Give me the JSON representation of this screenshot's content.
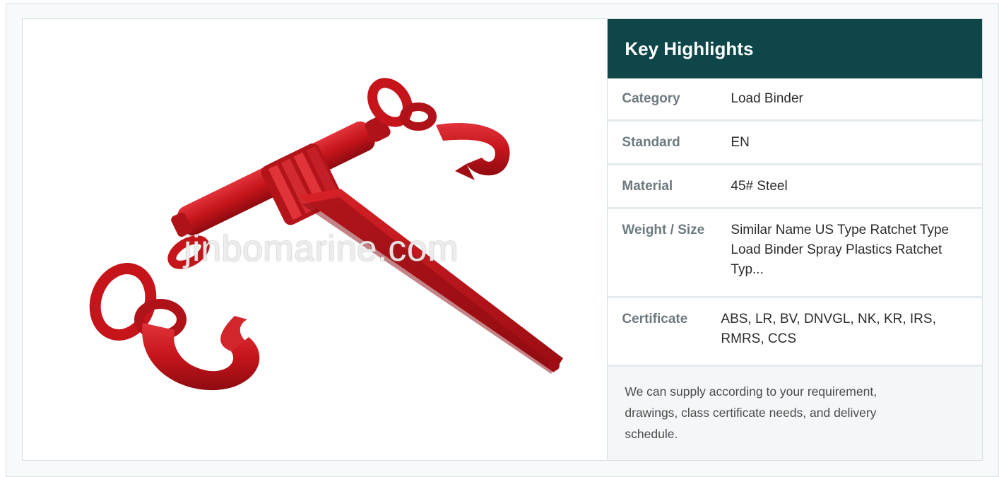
{
  "product_image": {
    "alt": "Red US type ratchet load binder with hooks",
    "watermark": "jinbomarine.com"
  },
  "highlights": {
    "title": "Key Highlights",
    "rows": [
      {
        "label": "Category",
        "value": "Load Binder"
      },
      {
        "label": "Standard",
        "value": "EN"
      },
      {
        "label": "Material",
        "value": "45# Steel"
      },
      {
        "label": "Weight / Size",
        "value": "Similar Name US Type Ratchet Type Load Binder Spray Plastics Ratchet Typ..."
      },
      {
        "label": "Certificate",
        "value": "ABS, LR, BV, DNVGL, NK, KR, IRS, RMRS, CCS"
      }
    ],
    "note": "We can supply according to your requirement, drawings, class certificate needs, and delivery schedule."
  },
  "colors": {
    "header_bg": "#0f4649",
    "label_text": "#6c7a80",
    "product_red": "#c8141a"
  }
}
